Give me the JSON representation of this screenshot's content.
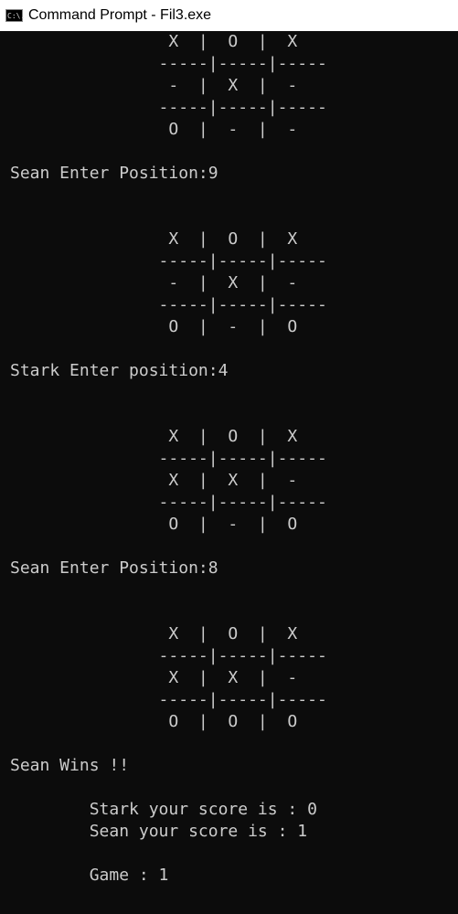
{
  "window": {
    "title": "Command Prompt - Fil3.exe",
    "icon": "cmd-icon",
    "icon_text": "C:\\."
  },
  "colors": {
    "background": "#0c0c0c",
    "text": "#cccccc",
    "titlebar": "#ffffff"
  },
  "console_lines": [
    "                X  |  O  |  X",
    "               -----|-----|-----",
    "                -  |  X  |  -",
    "               -----|-----|-----",
    "                O  |  -  |  -",
    "",
    "Sean Enter Position:9",
    "",
    "",
    "                X  |  O  |  X",
    "               -----|-----|-----",
    "                -  |  X  |  -",
    "               -----|-----|-----",
    "                O  |  -  |  O",
    "",
    "Stark Enter position:4",
    "",
    "",
    "                X  |  O  |  X",
    "               -----|-----|-----",
    "                X  |  X  |  -",
    "               -----|-----|-----",
    "                O  |  -  |  O",
    "",
    "Sean Enter Position:8",
    "",
    "",
    "                X  |  O  |  X",
    "               -----|-----|-----",
    "                X  |  X  |  -",
    "               -----|-----|-----",
    "                O  |  O  |  O",
    "",
    "Sean Wins !!",
    "",
    "        Stark your score is : 0",
    "        Sean your score is : 1",
    "",
    "        Game : 1",
    "",
    ""
  ]
}
